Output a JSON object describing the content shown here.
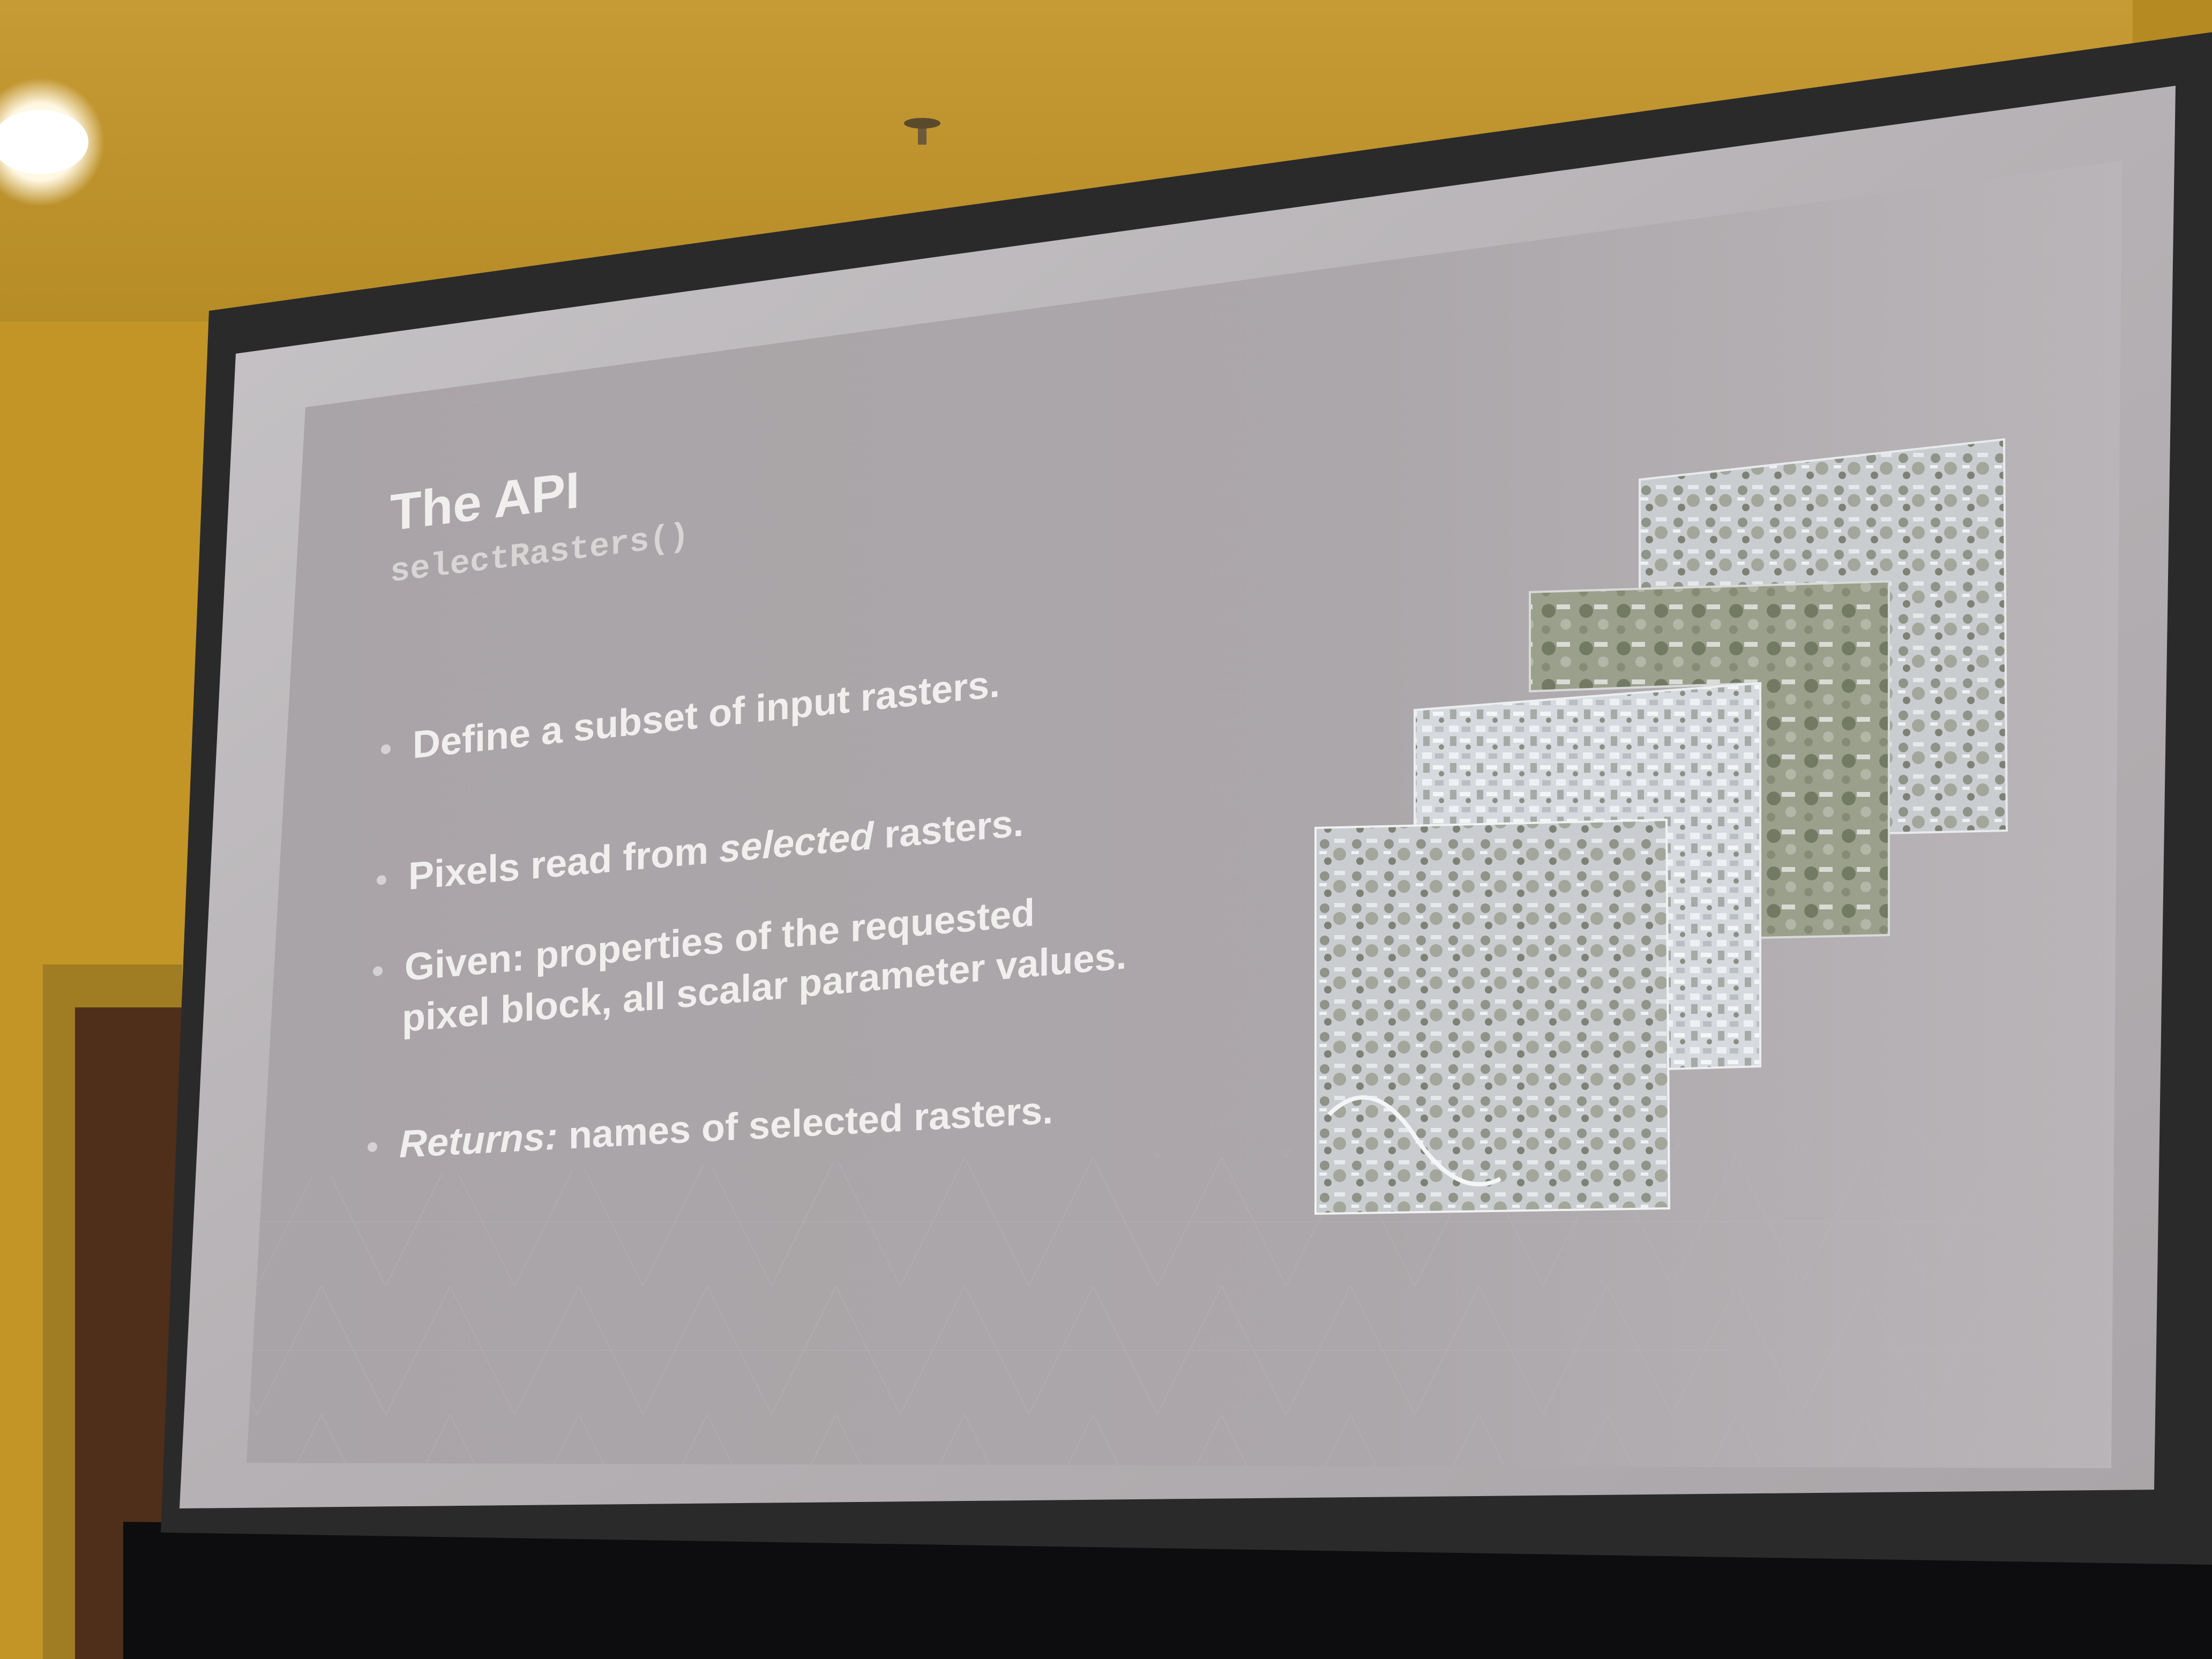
{
  "slide": {
    "title": "The API",
    "function_name": "selectRasters()",
    "bullets": [
      {
        "text": "Define a subset of input rasters."
      },
      {
        "pre": "Pixels read from ",
        "emph": "selected",
        "post": " rasters."
      },
      {
        "line1": "Given: properties of the requested",
        "line2": "pixel block, all scalar parameter values."
      },
      {
        "emph": "Returns:",
        "post": " names of selected rasters."
      }
    ]
  },
  "illustration": {
    "description_icon": "stacked-raster-images-icon",
    "layer_count": 4
  },
  "colors": {
    "wall": "#c2962a",
    "screen": "#b8b4b6",
    "screen_border": "#2b2a2a",
    "text": "#f1efee"
  }
}
